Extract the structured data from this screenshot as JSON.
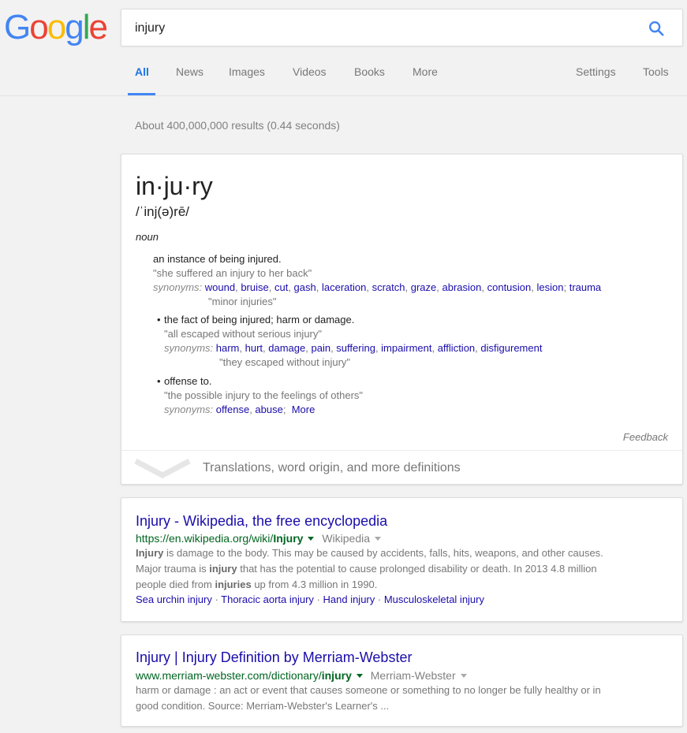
{
  "logo": {
    "letters": [
      "G",
      "o",
      "o",
      "g",
      "l",
      "e"
    ],
    "colors": [
      "#4285F4",
      "#EA4335",
      "#FBBC05",
      "#4285F4",
      "#34A853",
      "#EA4335"
    ]
  },
  "search": {
    "query": "injury"
  },
  "tabs": [
    "All",
    "News",
    "Images",
    "Videos",
    "Books",
    "More",
    "Settings",
    "Tools"
  ],
  "stats": "About 400,000,000 results (0.44 seconds)",
  "dictionary": {
    "word": "in·ju·ry",
    "phonetic": "/ˈinj(ə)rē/",
    "pos": "noun",
    "sense1": {
      "def": "an instance of being injured.",
      "example": "\"she suffered an injury to her back\"",
      "syn_label": "synonyms:",
      "synonyms": [
        "wound",
        "bruise",
        "cut",
        "gash",
        "laceration",
        "scratch",
        "graze",
        "abrasion",
        "contusion",
        "lesion",
        "trauma"
      ],
      "syn_example": "\"minor injuries\""
    },
    "sense2": {
      "bullet": "•",
      "def": "the fact of being injured; harm or damage.",
      "example": "\"all escaped without serious injury\"",
      "syn_label": "synonyms:",
      "synonyms": [
        "harm",
        "hurt",
        "damage",
        "pain",
        "suffering",
        "impairment",
        "affliction",
        "disfigurement"
      ],
      "syn_example": "\"they escaped without injury\""
    },
    "sense3": {
      "bullet": "•",
      "def": "offense to.",
      "example": "\"the possible injury to the feelings of others\"",
      "syn_label": "synonyms:",
      "synonyms": [
        "offense",
        "abuse"
      ],
      "more": "More"
    },
    "feedback": "Feedback",
    "more_defs": "Translations, word origin, and more definitions"
  },
  "result1": {
    "title": "Injury - Wikipedia, the free encyclopedia",
    "url_prefix": "https://en.wikipedia.org/wiki/",
    "url_bold": "Injury",
    "source": "Wikipedia",
    "snippet_line1_b": "Injury",
    "snippet_line1": " is damage to the body. This may be caused by accidents, falls, hits, weapons, and other causes.",
    "snippet_line2_a": "Major trauma is ",
    "snippet_line2_b": "injury",
    "snippet_line2_c": " that has the potential to cause prolonged disability or death. In 2013 4.8 million",
    "snippet_line3_a": "people died from ",
    "snippet_line3_b": "injuries",
    "snippet_line3_c": " up from 4.3 million in 1990.",
    "sitelinks": [
      "Sea urchin injury",
      "Thoracic aorta injury",
      "Hand injury",
      "Musculoskeletal injury"
    ],
    "sitelink_sep": " · "
  },
  "result2": {
    "title": "Injury | Injury Definition by Merriam-Webster",
    "url_prefix": "www.merriam-webster.com/dictionary/",
    "url_bold": "injury",
    "source": "Merriam-Webster",
    "snippet_line1": "harm or damage : an act or event that causes someone or something to no longer be fully healthy or in",
    "snippet_line2": "good condition. Source: Merriam-Webster's Learner's ..."
  }
}
